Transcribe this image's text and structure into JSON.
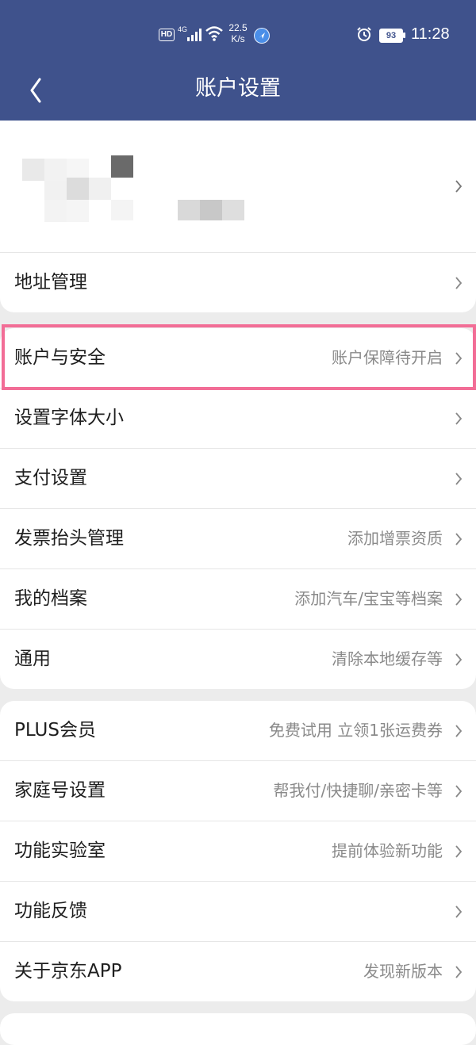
{
  "status_bar": {
    "hd": "HD",
    "network_gen": "4G",
    "speed_value": "22.5",
    "speed_unit": "K/s",
    "battery": "93",
    "time": "11:28"
  },
  "header": {
    "title": "账户设置"
  },
  "sections": [
    {
      "items": [
        {
          "label": "地址管理",
          "value": ""
        }
      ]
    },
    {
      "items": [
        {
          "label": "账户与安全",
          "value": "账户保障待开启"
        },
        {
          "label": "设置字体大小",
          "value": ""
        },
        {
          "label": "支付设置",
          "value": ""
        },
        {
          "label": "发票抬头管理",
          "value": "添加增票资质"
        },
        {
          "label": "我的档案",
          "value": "添加汽车/宝宝等档案"
        },
        {
          "label": "通用",
          "value": "清除本地缓存等"
        }
      ]
    },
    {
      "items": [
        {
          "label": "PLUS会员",
          "value": "免费试用 立领1张运费券"
        },
        {
          "label": "家庭号设置",
          "value": "帮我付/快捷聊/亲密卡等"
        },
        {
          "label": "功能实验室",
          "value": "提前体验新功能"
        },
        {
          "label": "功能反馈",
          "value": ""
        },
        {
          "label": "关于京东APP",
          "value": "发现新版本"
        }
      ]
    }
  ],
  "colors": {
    "header_bg": "#3f528c",
    "highlight": "#f26d96"
  }
}
